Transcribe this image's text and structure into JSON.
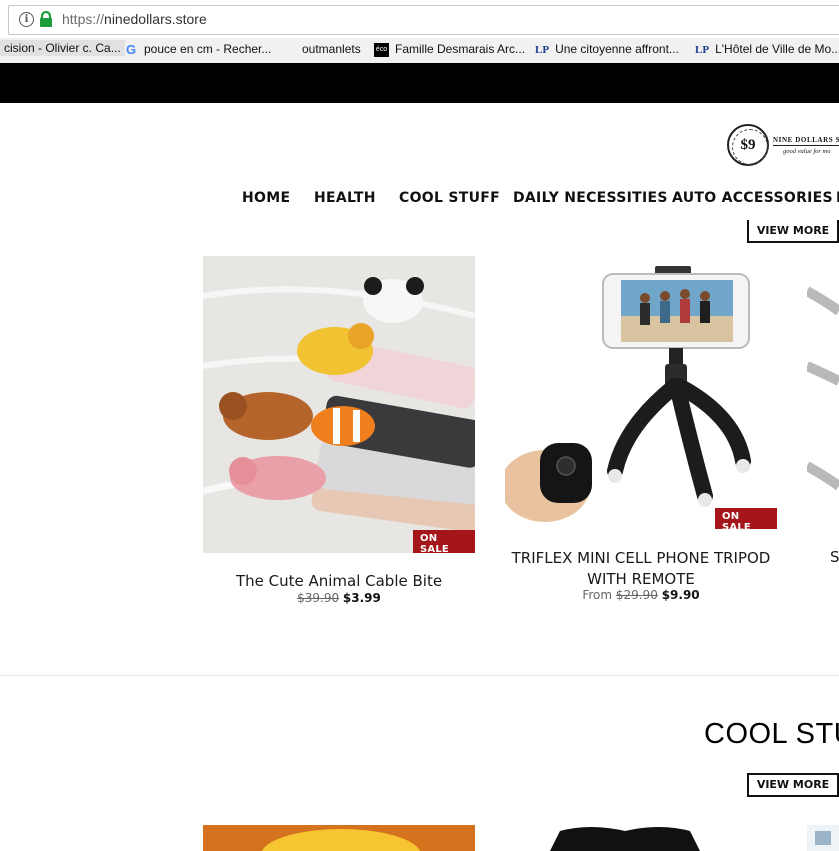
{
  "browser": {
    "url_protocol": "https://",
    "url_host": "ninedollars.store"
  },
  "bookmarks": [
    {
      "label": "cision - Olivier c. Ca...",
      "icon": "none"
    },
    {
      "label": "pouce en cm - Recher...",
      "icon": "google-icon"
    },
    {
      "label": "outmanlets",
      "icon": "none"
    },
    {
      "label": "Famille Desmarais Arc...",
      "icon": "eco-icon"
    },
    {
      "label": "Une citoyenne affront...",
      "icon": "lp-icon"
    },
    {
      "label": "L'Hôtel de Ville de Mo...",
      "icon": "lp-icon"
    }
  ],
  "icon_text": {
    "google": "G",
    "eco": "éco",
    "lp": "LP"
  },
  "logo": {
    "symbol": "$9",
    "name": "NINE DOLLARS S",
    "tagline": "good value for mo"
  },
  "nav": {
    "items": [
      "HOME",
      "HEALTH",
      "COOL STUFF",
      "DAILY NECESSITIES",
      "AUTO ACCESSORIES",
      "I"
    ]
  },
  "buttons": {
    "view_more": "VIEW MORE"
  },
  "products": [
    {
      "title": "The Cute Animal Cable Bite",
      "badge": "ON SALE",
      "price_from": "",
      "price_old": "$39.90",
      "price_new": "$3.99"
    },
    {
      "title_line1": "TRIFLEX MINI CELL PHONE TRIPOD",
      "title_line2": "WITH REMOTE",
      "badge": "ON SALE",
      "price_from": "From",
      "price_old": "$29.90",
      "price_new": "$9.90"
    },
    {
      "title": "S"
    }
  ],
  "section2": {
    "title": "COOL STU"
  },
  "colors": {
    "sale_badge": "#a4161a",
    "lock_green": "#1e9e3a",
    "header_band": "#000000"
  }
}
